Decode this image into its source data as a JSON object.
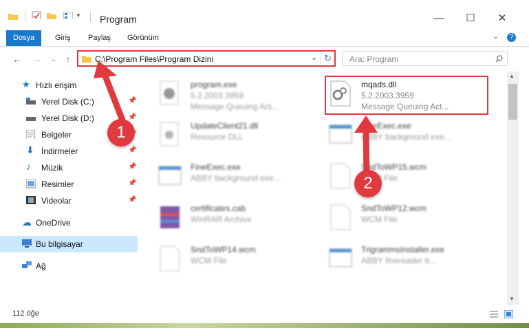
{
  "window": {
    "title": "Program"
  },
  "window_controls": {
    "minimize": "—",
    "maximize": "☐",
    "close": "✕"
  },
  "ribbon": {
    "tabs": [
      "Dosya",
      "Giriş",
      "Paylaş",
      "Görünüm"
    ]
  },
  "address": {
    "path": "C:\\Program Files\\Program Dizini"
  },
  "search": {
    "placeholder": "Ara: Program"
  },
  "sidebar": {
    "quick_access": "Hızlı erişim",
    "items": [
      "Yerel Disk (C:)",
      "Yerel Disk (D:)",
      "Belgeler",
      "İndirmeler",
      "Müzik",
      "Resimler",
      "Videolar"
    ],
    "onedrive": "OneDrive",
    "this_pc": "Bu bilgisayar",
    "network": "Ağ"
  },
  "files": [
    {
      "name": "program.exe",
      "line1": "5.2.2003.3959",
      "line2": "Message Queuing Act..."
    },
    {
      "name": "mqads.dll",
      "line1": "5.2.2003.3959",
      "line2": "Message Queuing Act..."
    },
    {
      "name": "UpdateClient21.dll",
      "line1": "Resource DLL",
      "line2": ""
    },
    {
      "name": "FineExec.exe",
      "line1": "ABBY background exe...",
      "line2": ""
    },
    {
      "name": "FineExec.exe",
      "line1": "ABBY background exe...",
      "line2": ""
    },
    {
      "name": "SndToWP15.wcm",
      "line1": "WCM File",
      "line2": ""
    },
    {
      "name": "certificates.cab",
      "line1": "WinRAR Archive",
      "line2": ""
    },
    {
      "name": "SndToWP12.wcm",
      "line1": "WCM File",
      "line2": ""
    },
    {
      "name": "SndToWP14.wcm",
      "line1": "WCM File",
      "line2": ""
    },
    {
      "name": "TrigrammsInstaller.exe",
      "line1": "ABBY finereader tr...",
      "line2": ""
    }
  ],
  "status": {
    "count": "112 öğe"
  },
  "annotations": {
    "badge1": "1",
    "badge2": "2"
  },
  "colors": {
    "accent": "#1979ca",
    "highlight": "#e0393e",
    "selection": "#cce8ff"
  }
}
